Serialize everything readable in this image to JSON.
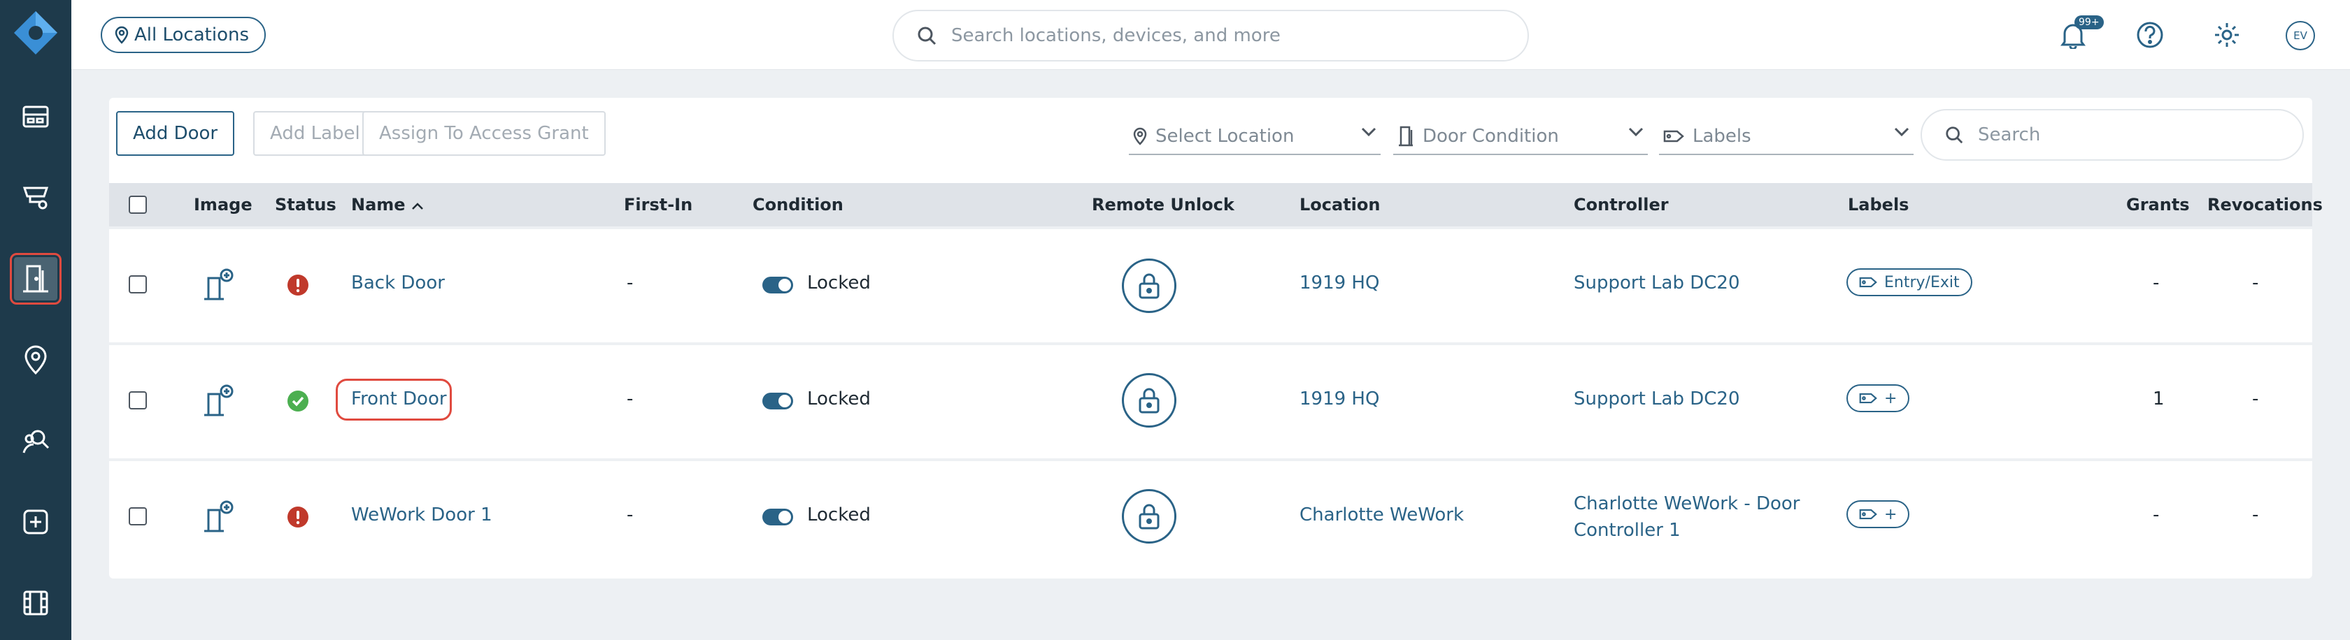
{
  "topbar": {
    "location_filter": "All Locations",
    "search_placeholder": "Search locations, devices, and more",
    "notification_badge": "99+",
    "avatar_initials": "EV"
  },
  "toolbar": {
    "add_door": "Add Door",
    "add_label": "Add Label",
    "assign_grant": "Assign To Access Grant",
    "select_location": "Select Location",
    "door_condition": "Door Condition",
    "labels": "Labels",
    "search_placeholder": "Search"
  },
  "table": {
    "headers": {
      "image": "Image",
      "status": "Status",
      "name": "Name",
      "first_in": "First-In",
      "condition": "Condition",
      "remote_unlock": "Remote Unlock",
      "location": "Location",
      "controller": "Controller",
      "labels": "Labels",
      "grants": "Grants",
      "revocations": "Revocations"
    },
    "rows": [
      {
        "status": "error",
        "name": "Back Door",
        "first_in": "-",
        "condition": "Locked",
        "location": "1919 HQ",
        "controller_line1": "Support Lab DC20",
        "controller_line2": "",
        "label": "Entry/Exit",
        "grants": "-",
        "revocations": "-"
      },
      {
        "status": "ok",
        "name": "Front Door",
        "first_in": "-",
        "condition": "Locked",
        "location": "1919 HQ",
        "controller_line1": "Support Lab DC20",
        "controller_line2": "",
        "label": "+",
        "grants": "1",
        "revocations": "-"
      },
      {
        "status": "error",
        "name": "WeWork Door 1",
        "first_in": "-",
        "condition": "Locked",
        "location": "Charlotte WeWork",
        "controller_line1": "Charlotte WeWork - Door",
        "controller_line2": "Controller 1",
        "label": "+",
        "grants": "-",
        "revocations": "-"
      }
    ]
  },
  "colors": {
    "sidebar": "#1e3a4b",
    "accent": "#2a6387",
    "error": "#c0392b",
    "success": "#4caf50",
    "highlight": "#e04a3f"
  }
}
